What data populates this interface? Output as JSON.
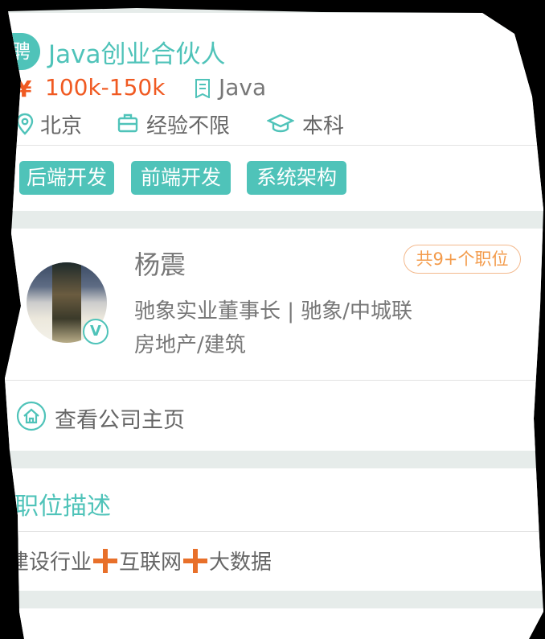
{
  "job": {
    "badge": "聘",
    "title": "Java创业合伙人",
    "salary_icon": "¥",
    "salary": "100k-150k",
    "tag_icon": "doc-icon",
    "tag": "Java",
    "meta": [
      {
        "icon": "location-icon",
        "label": "北京"
      },
      {
        "icon": "briefcase-icon",
        "label": "经验不限"
      },
      {
        "icon": "graduation-cap-icon",
        "label": "本科"
      }
    ],
    "skills": [
      "后端开发",
      "前端开发",
      "系统架构"
    ]
  },
  "recruiter": {
    "name": "杨震",
    "jobs_badge": "共9+个职位",
    "verified_badge": "V",
    "role": "驰象实业董事长 | 驰象/中城联",
    "industry": "房地产/建筑",
    "company_link": "查看公司主页"
  },
  "description": {
    "title": "职位描述",
    "parts": [
      "建设行业",
      "互联网",
      "大数据"
    ]
  },
  "colors": {
    "accent": "#4fc3b9",
    "salary": "#f05a22",
    "badge_orange": "#f39b4b",
    "plus": "#e8702a"
  }
}
